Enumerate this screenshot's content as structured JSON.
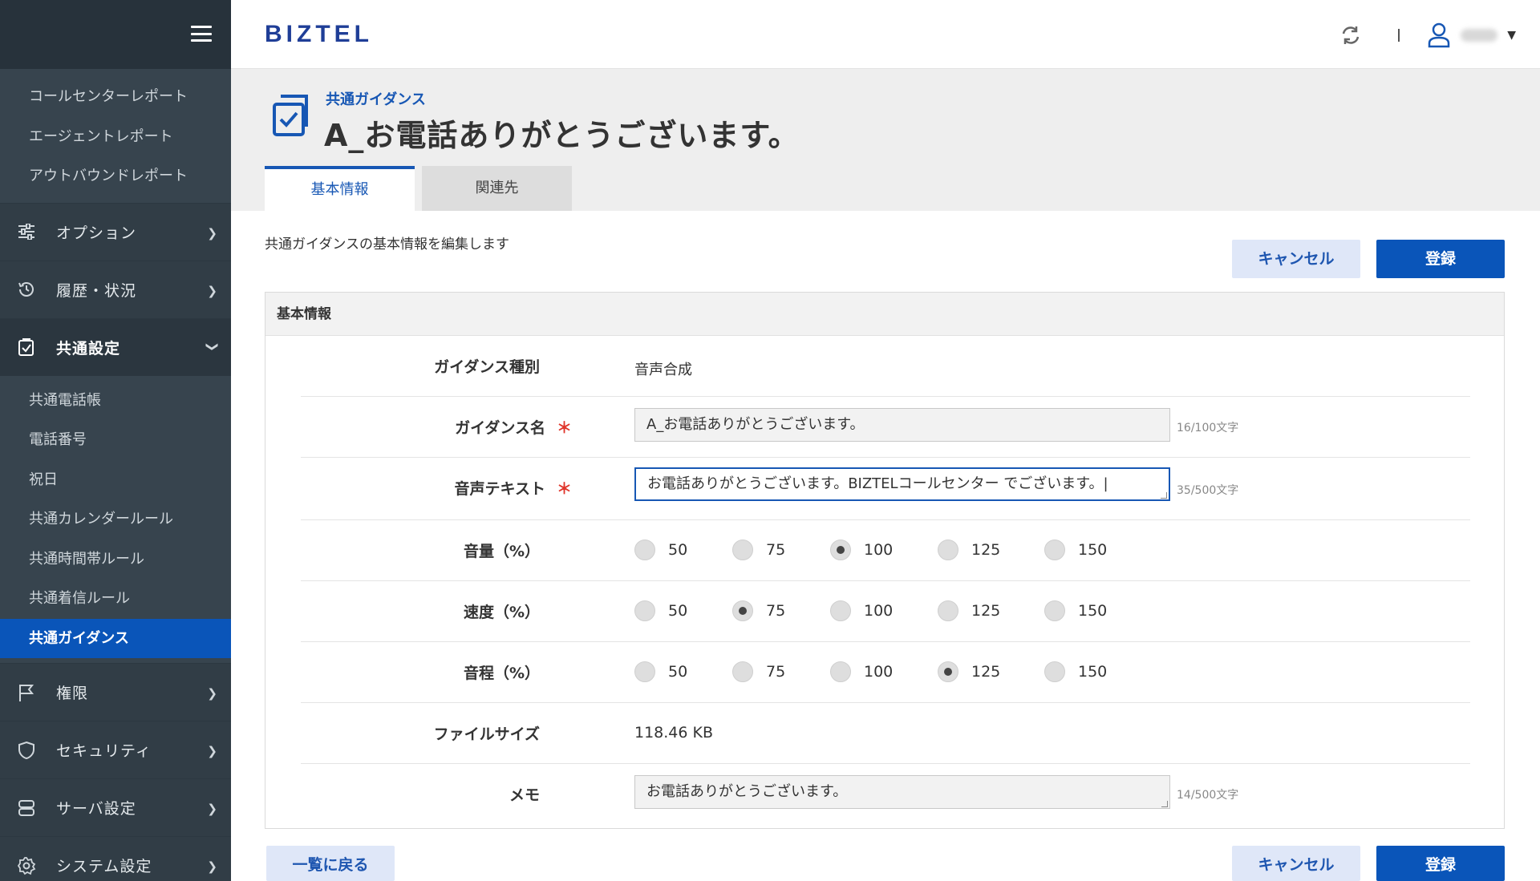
{
  "sidebar": {
    "report_items": [
      "コールセンターレポート",
      "エージェントレポート",
      "アウトバウンドレポート"
    ],
    "menu": [
      {
        "label": "オプション",
        "icon": "sliders-icon"
      },
      {
        "label": "履歴・状況",
        "icon": "history-icon"
      }
    ],
    "open_group": {
      "label": "共通設定",
      "icon": "checkbox-icon"
    },
    "sub_items": [
      "共通電話帳",
      "電話番号",
      "祝日",
      "共通カレンダールール",
      "共通時間帯ルール",
      "共通着信ルール",
      "共通ガイダンス"
    ],
    "active_sub": "共通ガイダンス",
    "menu_bottom": [
      {
        "label": "権限",
        "icon": "flag-icon"
      },
      {
        "label": "セキュリティ",
        "icon": "shield-icon"
      },
      {
        "label": "サーバ設定",
        "icon": "server-icon"
      },
      {
        "label": "システム設定",
        "icon": "gear-icon"
      }
    ]
  },
  "header": {
    "logo": "BIZTEL"
  },
  "page": {
    "breadcrumb": "共通ガイダンス",
    "title": "A_お電話ありがとうございます。",
    "tabs": [
      "基本情報",
      "関連先"
    ],
    "description": "共通ガイダンスの基本情報を編集します",
    "cancel_label": "キャンセル",
    "submit_label": "登録",
    "back_label": "一覧に戻る"
  },
  "form": {
    "section_title": "基本情報",
    "guidance_type_label": "ガイダンス種別",
    "guidance_type_value": "音声合成",
    "name_label": "ガイダンス名",
    "name_value": "A_お電話ありがとうございます。",
    "name_counter": "16/100文字",
    "text_label": "音声テキスト",
    "text_value": "お電話ありがとうございます。BIZTELコールセンター でございます。|",
    "text_counter": "35/500文字",
    "required_mark": "＊",
    "volume_label": "音量（%）",
    "speed_label": "速度（%）",
    "pitch_label": "音程（%）",
    "options": [
      "50",
      "75",
      "100",
      "125",
      "150"
    ],
    "volume_selected": "100",
    "speed_selected": "75",
    "pitch_selected": "125",
    "filesize_label": "ファイルサイズ",
    "filesize_value": "118.46 KB",
    "memo_label": "メモ",
    "memo_value": "お電話ありがとうございます。",
    "memo_counter": "14/500文字"
  }
}
